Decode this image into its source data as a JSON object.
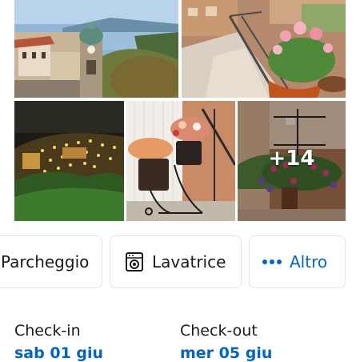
{
  "gallery": {
    "photos": [
      {
        "subject": "hillside town with bell tower and bay view"
      },
      {
        "subject": "balcony with potted geraniums"
      },
      {
        "subject": "village lit up at night"
      },
      {
        "subject": "indoor flower stand with potted plants"
      },
      {
        "subject": "balcony railing with hanging flowers"
      }
    ],
    "more_count": "+14"
  },
  "amenities": {
    "parking_label": "Parcheggio",
    "laundry_label": "Lavatrice",
    "more_label": "Altro",
    "laundry_icon": "washing-machine-icon",
    "more_icon": "dots-icon"
  },
  "stay": {
    "checkin_label": "Check-in",
    "checkin_date": "sab 01 giu",
    "checkout_label": "Check-out",
    "checkout_date": "mer 05 giu"
  },
  "colors": {
    "accent": "#0066cc",
    "chip_border": "#e3e3e3",
    "text": "#1a1a1a"
  }
}
